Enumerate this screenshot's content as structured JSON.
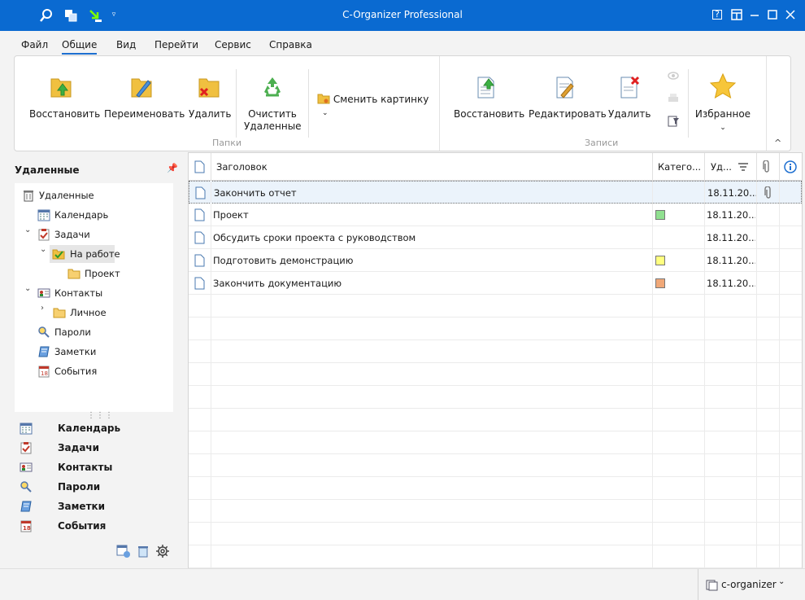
{
  "window": {
    "title": "C-Organizer Professional"
  },
  "menu": [
    "Файл",
    "Общие",
    "Вид",
    "Перейти",
    "Сервис",
    "Справка"
  ],
  "ribbon": {
    "folders_group": "Папки",
    "records_group": "Записи",
    "restore": "Восстановить",
    "rename": "Переименовать",
    "delete": "Удалить",
    "empty_line1": "Очистить",
    "empty_line2": "Удаленные",
    "change_picture": "Сменить картинку",
    "rec_restore": "Восстановить",
    "rec_edit": "Редактировать",
    "rec_delete": "Удалить",
    "favorites": "Избранное",
    "collapse": "^"
  },
  "left": {
    "title": "Удаленные",
    "tree": [
      {
        "label": "Удаленные"
      },
      {
        "label": "Календарь"
      },
      {
        "label": "Задачи"
      },
      {
        "label": "На работе"
      },
      {
        "label": "Проект"
      },
      {
        "label": "Контакты"
      },
      {
        "label": "Личное"
      },
      {
        "label": "Пароли"
      },
      {
        "label": "Заметки"
      },
      {
        "label": "События"
      }
    ],
    "nav": [
      "Календарь",
      "Задачи",
      "Контакты",
      "Пароли",
      "Заметки",
      "События"
    ]
  },
  "grid": {
    "headers": {
      "title": "Заголовок",
      "category": "Катего...",
      "date": "Уд..."
    },
    "rows": [
      {
        "title": "Закончить отчет",
        "category_color": "",
        "date": "18.11.20...",
        "attach": true
      },
      {
        "title": "Проект",
        "category_color": "#90e090",
        "date": "18.11.20...",
        "attach": false
      },
      {
        "title": "Обсудить сроки проекта с руководством",
        "category_color": "",
        "date": "18.11.20...",
        "attach": false
      },
      {
        "title": "Подготовить демонстрацию",
        "category_color": "#ffff80",
        "date": "18.11.20...",
        "attach": false
      },
      {
        "title": "Закончить документацию",
        "category_color": "#f0a878",
        "date": "18.11.20...",
        "attach": false
      }
    ]
  },
  "status": {
    "db": "c-organizer"
  },
  "colors": {
    "titlebar": "#0a6ad1",
    "accent": "#1e6fd0",
    "selection": "#ebf3fb"
  }
}
